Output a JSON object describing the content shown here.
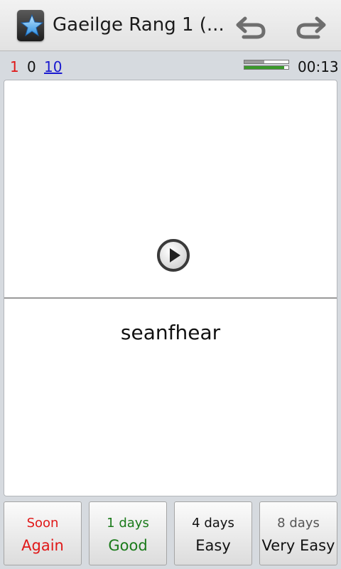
{
  "app": {
    "title": "Gaeilge Rang 1 (...",
    "icons": {
      "app": "ankidroid-star-icon",
      "undo": "undo-icon",
      "redo": "redo-icon"
    }
  },
  "stats": {
    "new_count": "1",
    "learn_count": "0",
    "review_count": "10",
    "colors": {
      "new": "#e01818",
      "learn": "#111111",
      "review": "#1a1ad0"
    }
  },
  "progress": {
    "session_fraction": 0.45,
    "deck_fraction": 0.9,
    "colors": {
      "session": "#9a9a9a",
      "deck": "#3a9a2a"
    }
  },
  "timer": "00:13",
  "card": {
    "play_icon": "play-audio-icon",
    "answer_text": "seanfhear"
  },
  "ease_buttons": [
    {
      "interval": "Soon",
      "label": "Again",
      "color": "#e01818"
    },
    {
      "interval": "1 days",
      "label": "Good",
      "color": "#1a7a1a"
    },
    {
      "interval": "4 days",
      "label": "Easy",
      "color": "#111111"
    },
    {
      "interval": "8 days",
      "label": "Very Easy",
      "color": "#111111"
    }
  ]
}
